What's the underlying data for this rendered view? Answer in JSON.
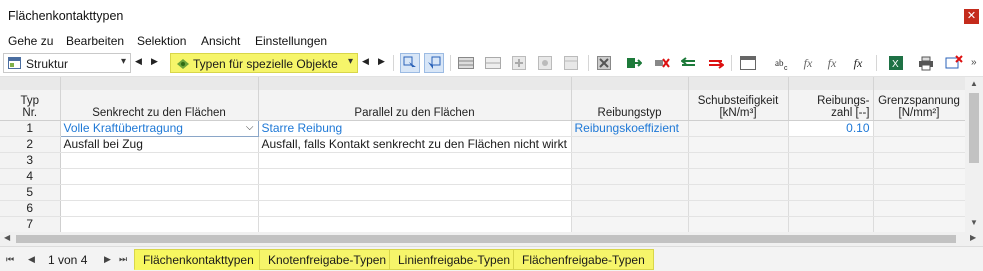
{
  "window": {
    "title": "Flächenkontakttypen",
    "close_icon": "close-icon"
  },
  "menu": [
    "Gehe zu",
    "Bearbeiten",
    "Selektion",
    "Ansicht",
    "Einstellungen"
  ],
  "toolbar": {
    "structure_combo": "Struktur",
    "types_combo": "Typen für spezielle Objekte",
    "accent_highlight": "#f6f56a"
  },
  "table": {
    "headers": {
      "nr_line1": "Typ",
      "nr_line2": "Nr.",
      "col1": "Senkrecht zu den Flächen",
      "col2": "Parallel zu den Flächen",
      "col3": "Reibungstyp",
      "col4_line1": "Schubsteifigkeit",
      "col4_line2": "[kN/m³]",
      "col5_line1": "Reibungs-",
      "col5_line2": "zahl [--]",
      "col6_line1": "Grenzspannung",
      "col6_line2": "[N/mm²]"
    },
    "rows": [
      {
        "nr": "1",
        "senkrecht": "Volle Kraftübertragung",
        "parallel": "Starre Reibung",
        "reibungstyp": "Reibungskoeffizient",
        "schub": "",
        "zahl": "0.10",
        "grenz": ""
      },
      {
        "nr": "2",
        "senkrecht": "Ausfall bei Zug",
        "parallel": "Ausfall, falls Kontakt senkrecht zu den Flächen nicht wirkt",
        "reibungstyp": "",
        "schub": "",
        "zahl": "",
        "grenz": ""
      },
      {
        "nr": "3",
        "senkrecht": "",
        "parallel": "",
        "reibungstyp": "",
        "schub": "",
        "zahl": "",
        "grenz": ""
      },
      {
        "nr": "4",
        "senkrecht": "",
        "parallel": "",
        "reibungstyp": "",
        "schub": "",
        "zahl": "",
        "grenz": ""
      },
      {
        "nr": "5",
        "senkrecht": "",
        "parallel": "",
        "reibungstyp": "",
        "schub": "",
        "zahl": "",
        "grenz": ""
      },
      {
        "nr": "6",
        "senkrecht": "",
        "parallel": "",
        "reibungstyp": "",
        "schub": "",
        "zahl": "",
        "grenz": ""
      },
      {
        "nr": "7",
        "senkrecht": "",
        "parallel": "",
        "reibungstyp": "",
        "schub": "",
        "zahl": "",
        "grenz": ""
      }
    ]
  },
  "pager": {
    "label": "1 von 4"
  },
  "tabs": [
    "Flächenkontakttypen",
    "Knotenfreigabe-Typen",
    "Linienfreigabe-Typen",
    "Flächenfreigabe-Typen"
  ]
}
